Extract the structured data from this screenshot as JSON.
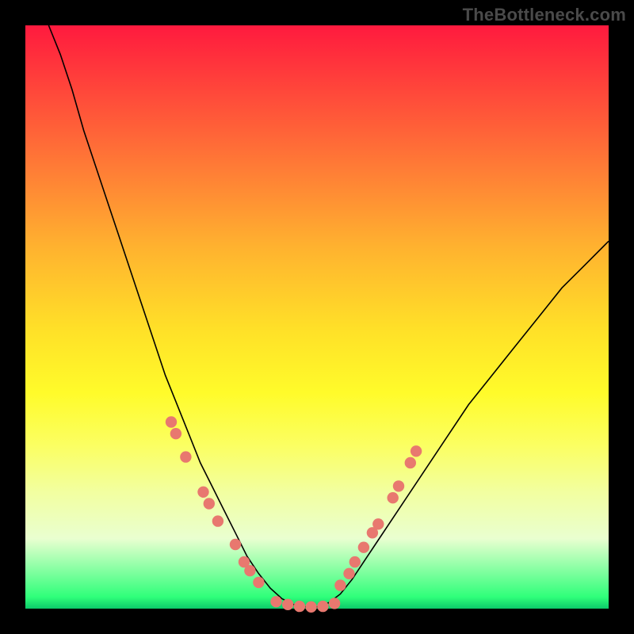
{
  "watermark": "TheBottleneck.com",
  "colors": {
    "gradient_top": "#ff1a3e",
    "gradient_bottom": "#0cc96a",
    "curve": "#000000",
    "dots": "#e8786f",
    "page_bg": "#000000"
  },
  "chart_data": {
    "type": "line",
    "title": "",
    "xlabel": "",
    "ylabel": "",
    "xlim": [
      0,
      100
    ],
    "ylim": [
      0,
      100
    ],
    "grid": false,
    "legend": false,
    "series": [
      {
        "name": "bottleneck-curve",
        "x": [
          4,
          6,
          8,
          10,
          12,
          14,
          16,
          18,
          20,
          22,
          24,
          26,
          28,
          30,
          32,
          34,
          36,
          38,
          40,
          42,
          44,
          46,
          48,
          50,
          52,
          54,
          56,
          58,
          60,
          64,
          68,
          72,
          76,
          80,
          84,
          88,
          92,
          96,
          100
        ],
        "y": [
          100,
          95,
          89,
          82,
          76,
          70,
          64,
          58,
          52,
          46,
          40,
          35,
          30,
          25,
          21,
          17,
          13,
          9,
          6,
          3.5,
          1.7,
          0.7,
          0.3,
          0.3,
          1.0,
          2.5,
          5,
          8,
          11,
          17,
          23,
          29,
          35,
          40,
          45,
          50,
          55,
          59,
          63
        ]
      }
    ],
    "annotations": {
      "dots_left": [
        {
          "x": 25,
          "y": 32
        },
        {
          "x": 25.8,
          "y": 30
        },
        {
          "x": 27.5,
          "y": 26
        },
        {
          "x": 30.5,
          "y": 20
        },
        {
          "x": 31.5,
          "y": 18
        },
        {
          "x": 33,
          "y": 15
        },
        {
          "x": 36,
          "y": 11
        },
        {
          "x": 37.5,
          "y": 8
        },
        {
          "x": 38.5,
          "y": 6.5
        },
        {
          "x": 40,
          "y": 4.5
        }
      ],
      "dots_right": [
        {
          "x": 54,
          "y": 4
        },
        {
          "x": 55.5,
          "y": 6
        },
        {
          "x": 56.5,
          "y": 8
        },
        {
          "x": 58,
          "y": 10.5
        },
        {
          "x": 59.5,
          "y": 13
        },
        {
          "x": 60.5,
          "y": 14.5
        },
        {
          "x": 63,
          "y": 19
        },
        {
          "x": 64,
          "y": 21
        },
        {
          "x": 66,
          "y": 25
        },
        {
          "x": 67,
          "y": 27
        }
      ],
      "dots_bottom": [
        {
          "x": 43,
          "y": 1.2
        },
        {
          "x": 45,
          "y": 0.7
        },
        {
          "x": 47,
          "y": 0.4
        },
        {
          "x": 49,
          "y": 0.3
        },
        {
          "x": 51,
          "y": 0.4
        },
        {
          "x": 53,
          "y": 0.9
        }
      ]
    }
  }
}
